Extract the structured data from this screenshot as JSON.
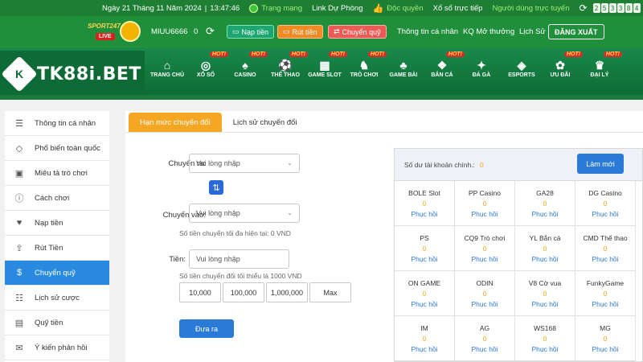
{
  "topbar": {
    "date": "Ngày 21 Tháng 11 Năm 2024",
    "time": "13:47:46",
    "status_label": "Trạng mạng",
    "status_value": "Link Dự Phòng",
    "exclusive_label": "Độc quyền",
    "lottery_label": "Xổ số trực tiếp",
    "online_label": "Người dùng trực tuyến",
    "online_digits": [
      "2",
      "5",
      "3",
      "3",
      "8",
      "4"
    ]
  },
  "account": {
    "sport_brand": "SPORT247",
    "sport_live": "LIVE",
    "username": "MIUU6666",
    "balance": "0",
    "deposit_button": "Nạp tiền",
    "withdraw_button": "Rút tiền",
    "transfer_button": "Chuyển quỹ",
    "links": [
      "Thông tin cá nhân",
      "KQ Mở thưởng",
      "Lịch Sử"
    ],
    "logout_button": "ĐĂNG XUẤT"
  },
  "brand": {
    "logo_mark": "K",
    "logo_text": "TK88i.BET"
  },
  "nav": {
    "hot_badge": "HOT!",
    "items": [
      {
        "label": "TRANG CHỦ",
        "icon": "home-icon",
        "glyph": "⌂",
        "hot": false
      },
      {
        "label": "XỔ SỐ",
        "icon": "lottery-icon",
        "glyph": "◎",
        "hot": true
      },
      {
        "label": "CASINO",
        "icon": "casino-icon",
        "glyph": "♠",
        "hot": true
      },
      {
        "label": "THỂ THAO",
        "icon": "sports-icon",
        "glyph": "⚽",
        "hot": true
      },
      {
        "label": "GAME SLOT",
        "icon": "slot-icon",
        "glyph": "▦",
        "hot": true
      },
      {
        "label": "TRÒ CHƠI",
        "icon": "games-icon",
        "glyph": "♞",
        "hot": true
      },
      {
        "label": "GAME BÀI",
        "icon": "cards-icon",
        "glyph": "♣",
        "hot": false
      },
      {
        "label": "BẮN CÁ",
        "icon": "fishing-icon",
        "glyph": "❖",
        "hot": true
      },
      {
        "label": "ĐÁ GÀ",
        "icon": "cockfight-icon",
        "glyph": "✦",
        "hot": false
      },
      {
        "label": "ESPORTS",
        "icon": "esports-icon",
        "glyph": "◈",
        "hot": false
      },
      {
        "label": "ƯU ĐÃI",
        "icon": "promo-icon",
        "glyph": "✿",
        "hot": true
      },
      {
        "label": "ĐẠI LÝ",
        "icon": "agent-icon",
        "glyph": "♛",
        "hot": true
      }
    ]
  },
  "sidebar": {
    "items": [
      {
        "label": "Thông tin cá nhân",
        "icon": "user-card-icon",
        "glyph": "☰"
      },
      {
        "label": "Phổ biến toàn quốc",
        "icon": "diamond-icon",
        "glyph": "◇"
      },
      {
        "label": "Miêu tả trò chơi",
        "icon": "gamepad-icon",
        "glyph": "▣"
      },
      {
        "label": "Cách chơi",
        "icon": "info-icon",
        "glyph": "ⓘ"
      },
      {
        "label": "Nạp tiền",
        "icon": "piggy-bank-icon",
        "glyph": "♥"
      },
      {
        "label": "Rút Tiền",
        "icon": "withdraw-icon",
        "glyph": "⇪"
      },
      {
        "label": "Chuyển quỹ",
        "icon": "dollar-icon",
        "glyph": "$"
      },
      {
        "label": "Lịch sử cược",
        "icon": "history-icon",
        "glyph": "☷"
      },
      {
        "label": "Quỹ tiền",
        "icon": "fund-icon",
        "glyph": "▤"
      },
      {
        "label": "Ý kiến phản hồi",
        "icon": "feedback-icon",
        "glyph": "✉"
      }
    ],
    "active_index": 6
  },
  "tabs": [
    "Hạn mức chuyển đổi",
    "Lịch sử chuyển đổi"
  ],
  "form": {
    "from_label": "Chuyển ra:",
    "from_placeholder": "Vui lòng nhập",
    "to_label": "Chuyển vào:",
    "to_placeholder": "Vui lòng nhập",
    "max_note": "Số tiền chuyển tối đa hiện tại:  0 VND",
    "amount_label": "Tiền:",
    "amount_placeholder": "Vui lòng nhập",
    "min_note": "Số tiền chuyển đổi tối thiểu là 1000 VND",
    "quick_amounts": [
      "10,000",
      "100,000",
      "1,000,000",
      "Max"
    ],
    "submit_button": "Đưa ra"
  },
  "wallet": {
    "main_label": "Số dư tài khoản chính.:",
    "main_value": "0",
    "refresh_button": "Làm mới",
    "restore_label": "Phục hồi",
    "providers": [
      {
        "name": "BOLE Slot",
        "value": "0"
      },
      {
        "name": "PP Casino",
        "value": "0"
      },
      {
        "name": "GA28",
        "value": "0"
      },
      {
        "name": "DG Casino",
        "value": "0"
      },
      {
        "name": "PS",
        "value": "0"
      },
      {
        "name": "CQ9 Trò chơi",
        "value": "0"
      },
      {
        "name": "YL Bắn cá",
        "value": "0"
      },
      {
        "name": "CMD Thể thao",
        "value": "0"
      },
      {
        "name": "ON GAME",
        "value": "0"
      },
      {
        "name": "ODIN",
        "value": "0"
      },
      {
        "name": "V8 Cờ vua",
        "value": "0"
      },
      {
        "name": "FunkyGame",
        "value": "0"
      },
      {
        "name": "IM",
        "value": "0"
      },
      {
        "name": "AG",
        "value": "0"
      },
      {
        "name": "WS168",
        "value": "0"
      },
      {
        "name": "MG",
        "value": "0"
      }
    ]
  },
  "colors": {
    "header_green": "#1f8f3c",
    "active_blue": "#2a8ae0",
    "tab_orange": "#f5a623",
    "button_blue": "#2a7ad8"
  }
}
